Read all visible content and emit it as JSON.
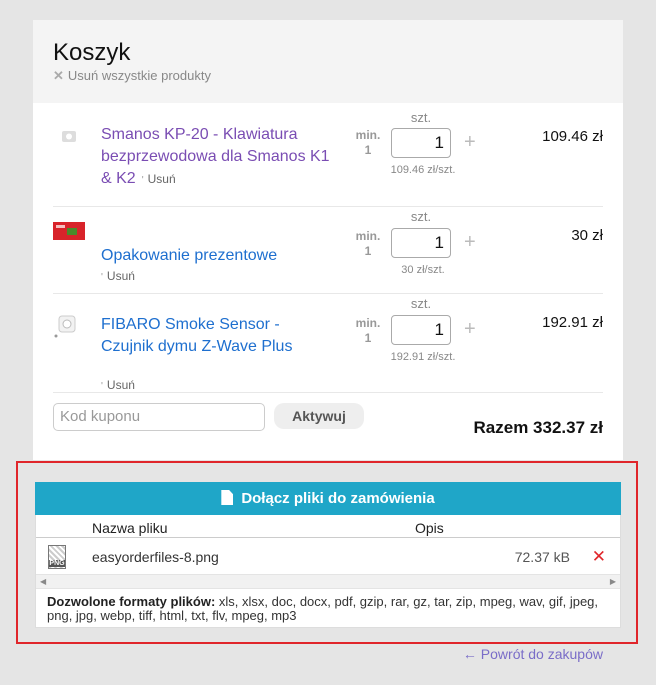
{
  "cart": {
    "title": "Koszyk",
    "remove_all": "Usuń wszystkie produkty",
    "remove_all_icon": "close-icon"
  },
  "items": [
    {
      "name": "Smanos KP-20 - Klawiatura bezprzewodowa dla Smanos K1 & K2",
      "remove": "Usuń",
      "min_label": "min.",
      "min_value": "1",
      "qty_label": "szt.",
      "qty": "1",
      "unit_price": "109.46 zł/szt.",
      "price": "109.46 zł"
    },
    {
      "name": "Opakowanie prezentowe",
      "remove": "Usuń",
      "min_label": "min.",
      "min_value": "1",
      "qty_label": "szt.",
      "qty": "1",
      "unit_price": "30 zł/szt.",
      "price": "30 zł"
    },
    {
      "name": "FIBARO Smoke Sensor - Czujnik dymu Z-Wave Plus",
      "remove": "Usuń",
      "min_label": "min.",
      "min_value": "1",
      "qty_label": "szt.",
      "qty": "1",
      "unit_price": "192.91 zł/szt.",
      "price": "192.91 zł"
    }
  ],
  "coupon": {
    "placeholder": "Kod kuponu",
    "activate": "Aktywuj"
  },
  "total": "Razem 332.37 zł",
  "attachments": {
    "button": "Dołącz pliki do zamówienia",
    "col_name": "Nazwa pliku",
    "col_desc": "Opis",
    "files": [
      {
        "icon_text": "PNG",
        "name": "easyorderfiles-8.png",
        "size": "72.37 kB"
      }
    ],
    "formats_label": "Dozwolone formaty plików:",
    "formats": "xls, xlsx, doc, docx, pdf, gzip, rar, gz, tar, zip, mpeg, wav, gif, jpeg, png, jpg, webp, tiff, html, txt, flv, mpeg, mp3"
  },
  "back_link": "← Powrót do zakupów",
  "colors": {
    "accent": "#1fa6c8",
    "highlight_border": "#e0262b",
    "link_purple": "#7a4db3",
    "link_blue": "#1e6fcf"
  }
}
